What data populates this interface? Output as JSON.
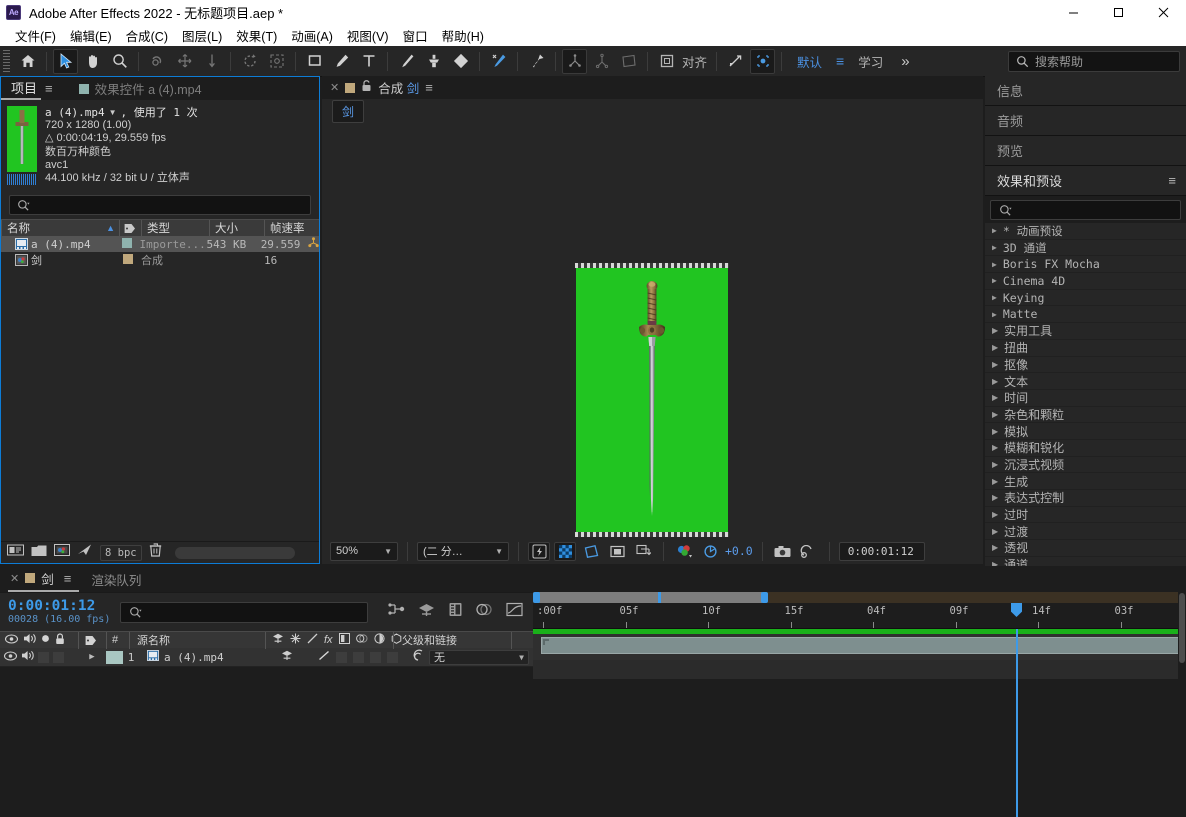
{
  "window": {
    "app_badge": "Ae",
    "title": "Adobe After Effects 2022 - 无标题项目.aep *",
    "minimize": "—",
    "maximize": "□",
    "close": "✕"
  },
  "menubar": [
    {
      "label": "文件(F)",
      "name": "menu-file"
    },
    {
      "label": "编辑(E)",
      "name": "menu-edit"
    },
    {
      "label": "合成(C)",
      "name": "menu-composition"
    },
    {
      "label": "图层(L)",
      "name": "menu-layer"
    },
    {
      "label": "效果(T)",
      "name": "menu-effect"
    },
    {
      "label": "动画(A)",
      "name": "menu-animation"
    },
    {
      "label": "视图(V)",
      "name": "menu-view"
    },
    {
      "label": "窗口",
      "name": "menu-window"
    },
    {
      "label": "帮助(H)",
      "name": "menu-help"
    }
  ],
  "toolbar": {
    "align_label": "对齐",
    "workspace_current": "默认",
    "workspace_learn": "学习",
    "overflow": "»",
    "help_placeholder": "搜索帮助"
  },
  "project_panel": {
    "tab_active": "项目",
    "tab_menu_icon": "hamburger-icon",
    "tab_inactive": "效果控件 a (4).mp4",
    "asset": {
      "name": "a (4).mp4",
      "usage": ", 使用了 1 次",
      "dimensions": "720 x 1280 (1.00)",
      "duration": "△ 0:00:04:19, 29.559 fps",
      "colors": "数百万种颜色",
      "codec": "avc1",
      "audio": "44.100 kHz / 32 bit U / 立体声"
    },
    "search_placeholder": "",
    "columns": [
      "名称",
      "类型",
      "大小",
      "帧速率"
    ],
    "rows": [
      {
        "name": "a (4).mp4",
        "type": "Importe...X",
        "size": "543 KB",
        "fps": "29.559",
        "selected": true,
        "icon": "movie-icon"
      },
      {
        "name": "剑",
        "type": "合成",
        "size": "",
        "fps": "16",
        "selected": false,
        "icon": "comp-icon"
      }
    ],
    "footer": {
      "bit_depth": "8 bpc"
    }
  },
  "comp_panel": {
    "tab_label_prefix": "合成",
    "tab_label_name": "剑",
    "breadcrumb_chip": "剑",
    "zoom": "50%",
    "resolution": "(二 分…",
    "exposure": "+0.0",
    "timecode": "0:00:01:12",
    "canvas_bg_color": "#21c521"
  },
  "right_rail": {
    "tabs": [
      "信息",
      "音频",
      "预览"
    ],
    "current_tab": "效果和预设",
    "search_placeholder": "",
    "categories": [
      {
        "label": "* 动画预设",
        "mono": true
      },
      {
        "label": "3D 通道",
        "mono": true
      },
      {
        "label": "Boris FX Mocha",
        "mono": true
      },
      {
        "label": "Cinema 4D",
        "mono": true
      },
      {
        "label": "Keying",
        "mono": true
      },
      {
        "label": "Matte",
        "mono": true
      },
      {
        "label": "实用工具",
        "mono": false
      },
      {
        "label": "扭曲",
        "mono": false
      },
      {
        "label": "抠像",
        "mono": false
      },
      {
        "label": "文本",
        "mono": false
      },
      {
        "label": "时间",
        "mono": false
      },
      {
        "label": "杂色和颗粒",
        "mono": false
      },
      {
        "label": "模拟",
        "mono": false
      },
      {
        "label": "模糊和锐化",
        "mono": false
      },
      {
        "label": "沉浸式视频",
        "mono": false
      },
      {
        "label": "生成",
        "mono": false
      },
      {
        "label": "表达式控制",
        "mono": false
      },
      {
        "label": "过时",
        "mono": false
      },
      {
        "label": "过渡",
        "mono": false
      },
      {
        "label": "透视",
        "mono": false
      },
      {
        "label": "通道",
        "mono": false
      }
    ]
  },
  "timeline": {
    "tab_active": "剑",
    "tab_render_queue": "渲染队列",
    "current_time": "0:00:01:12",
    "frame_info": "00028 (16.00 fps)",
    "search_placeholder": "",
    "columns": {
      "source_name": "源名称",
      "parent_and_link": "父级和链接",
      "hash": "#"
    },
    "layers": [
      {
        "index": "1",
        "name": "a (4).mp4",
        "parent": "无",
        "color": "#a9c7c2"
      }
    ],
    "ruler_ticks": [
      ":00f",
      "05f",
      "10f",
      "15f",
      "04f",
      "09f",
      "14f",
      "03f"
    ],
    "playhead_label": "0:00:01:12",
    "work_area_color": "#1ab01a"
  }
}
